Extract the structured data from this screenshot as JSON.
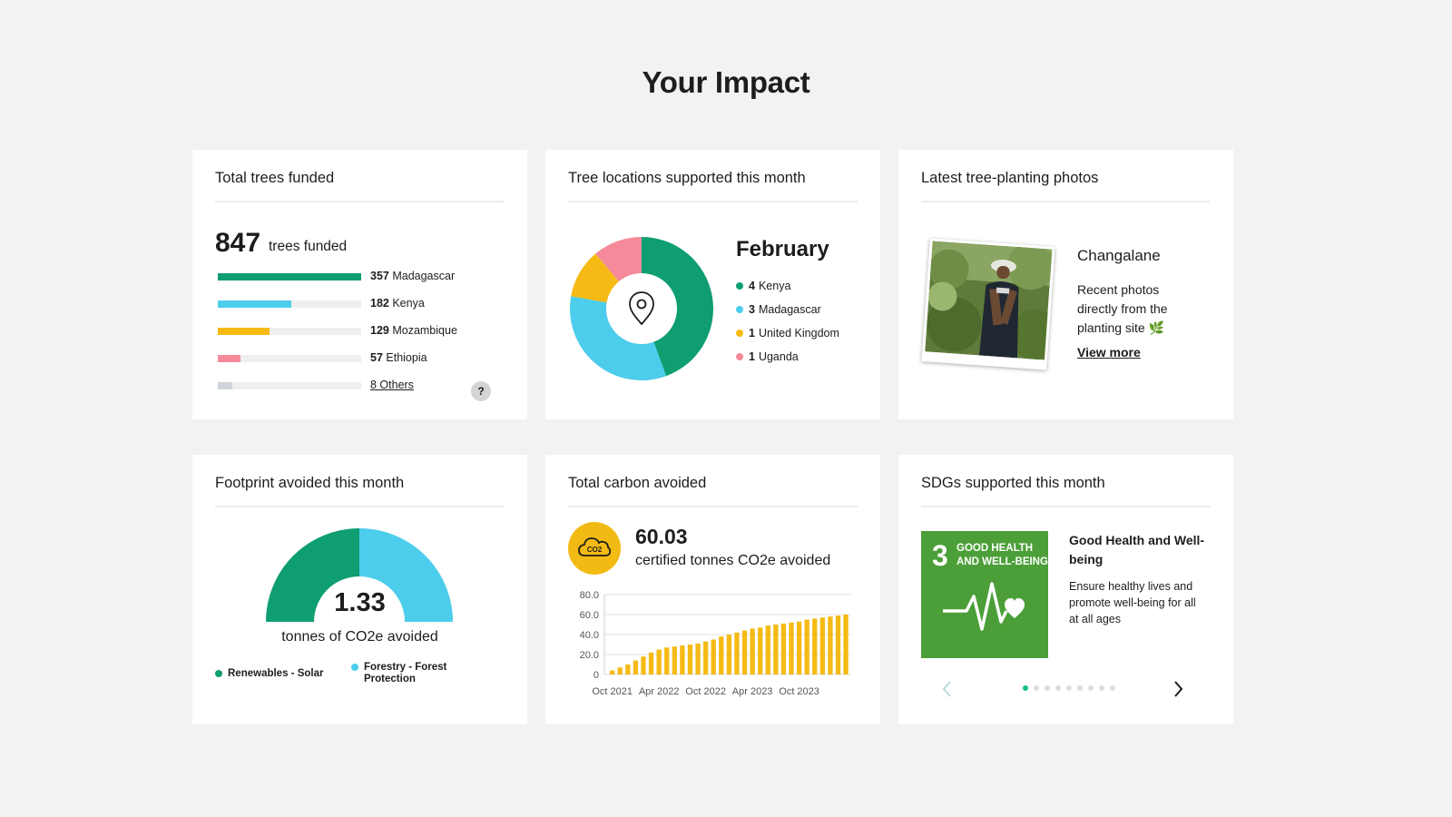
{
  "page": {
    "title": "Your Impact"
  },
  "trees": {
    "title": "Total trees funded",
    "total": "847",
    "unit": "trees funded",
    "bars": [
      {
        "count": "357",
        "label": "Madagascar",
        "fraction": 1.0,
        "color": "#0e9e72"
      },
      {
        "count": "182",
        "label": "Kenya",
        "fraction": 0.51,
        "color": "#4dcdec"
      },
      {
        "count": "129",
        "label": "Mozambique",
        "fraction": 0.36,
        "color": "#f5bb14"
      },
      {
        "count": "57",
        "label": "Ethiopia",
        "fraction": 0.16,
        "color": "#f48a9a"
      },
      {
        "count": "8 Others",
        "label": "",
        "fraction": 0.1,
        "color": "#cfd4da"
      }
    ],
    "help_label": "?"
  },
  "locations": {
    "title": "Tree locations supported this month",
    "month": "February",
    "legend": [
      {
        "count": "4",
        "label": "Kenya",
        "color": "#0e9e72",
        "value": 4
      },
      {
        "count": "3",
        "label": "Madagascar",
        "color": "#4dcdec",
        "value": 3
      },
      {
        "count": "1",
        "label": "United Kingdom",
        "color": "#f5bb14",
        "value": 1
      },
      {
        "count": "1",
        "label": "Uganda",
        "color": "#f48a9a",
        "value": 1
      }
    ],
    "center_icon": "map-pin-icon"
  },
  "photos": {
    "title": "Latest tree-planting photos",
    "place": "Changalane",
    "description": "Recent photos directly from the planting site 🌿",
    "link": "View more"
  },
  "footprint": {
    "title": "Footprint avoided this month",
    "value": "1.33",
    "unit": "tonnes of CO2e avoided",
    "segments": [
      {
        "label": "Renewables - Solar",
        "color": "#0e9e72",
        "fraction": 0.5
      },
      {
        "label": "Forestry - Forest Protection",
        "color": "#4dcdec",
        "fraction": 0.5
      }
    ]
  },
  "carbon": {
    "title": "Total carbon avoided",
    "value": "60.03",
    "unit": "certified tonnes CO2e avoided",
    "icon": "co2-cloud-icon",
    "icon_label": "CO2"
  },
  "chart_data": {
    "type": "bar",
    "color": "#f5bb14",
    "ylim": [
      0,
      80
    ],
    "yticks": [
      "80.0",
      "60.0",
      "40.0",
      "20.0",
      "0"
    ],
    "ytick_values": [
      80,
      60,
      40,
      20,
      0
    ],
    "xtick_labels": [
      "Oct 2021",
      "Apr 2022",
      "Oct 2022",
      "Apr 2023",
      "Oct 2023"
    ],
    "xtick_index": [
      0,
      6,
      12,
      18,
      24
    ],
    "values": [
      4,
      7,
      10,
      14,
      18,
      22,
      25,
      27,
      28,
      29,
      30,
      31,
      33,
      35,
      38,
      40,
      42,
      44,
      46,
      47,
      49,
      50,
      51,
      52,
      53,
      55,
      56,
      57,
      58,
      59,
      60
    ]
  },
  "sdg": {
    "title": "SDGs supported this month",
    "tile_number": "3",
    "tile_text_1": "GOOD HEALTH",
    "tile_text_2": "AND WELL-BEING",
    "tile_color": "#4c9f38",
    "heading": "Good Health and Well-being",
    "description": "Ensure healthy lives and promote well-being for all at all ages",
    "pages": 9,
    "active_page": 1
  }
}
